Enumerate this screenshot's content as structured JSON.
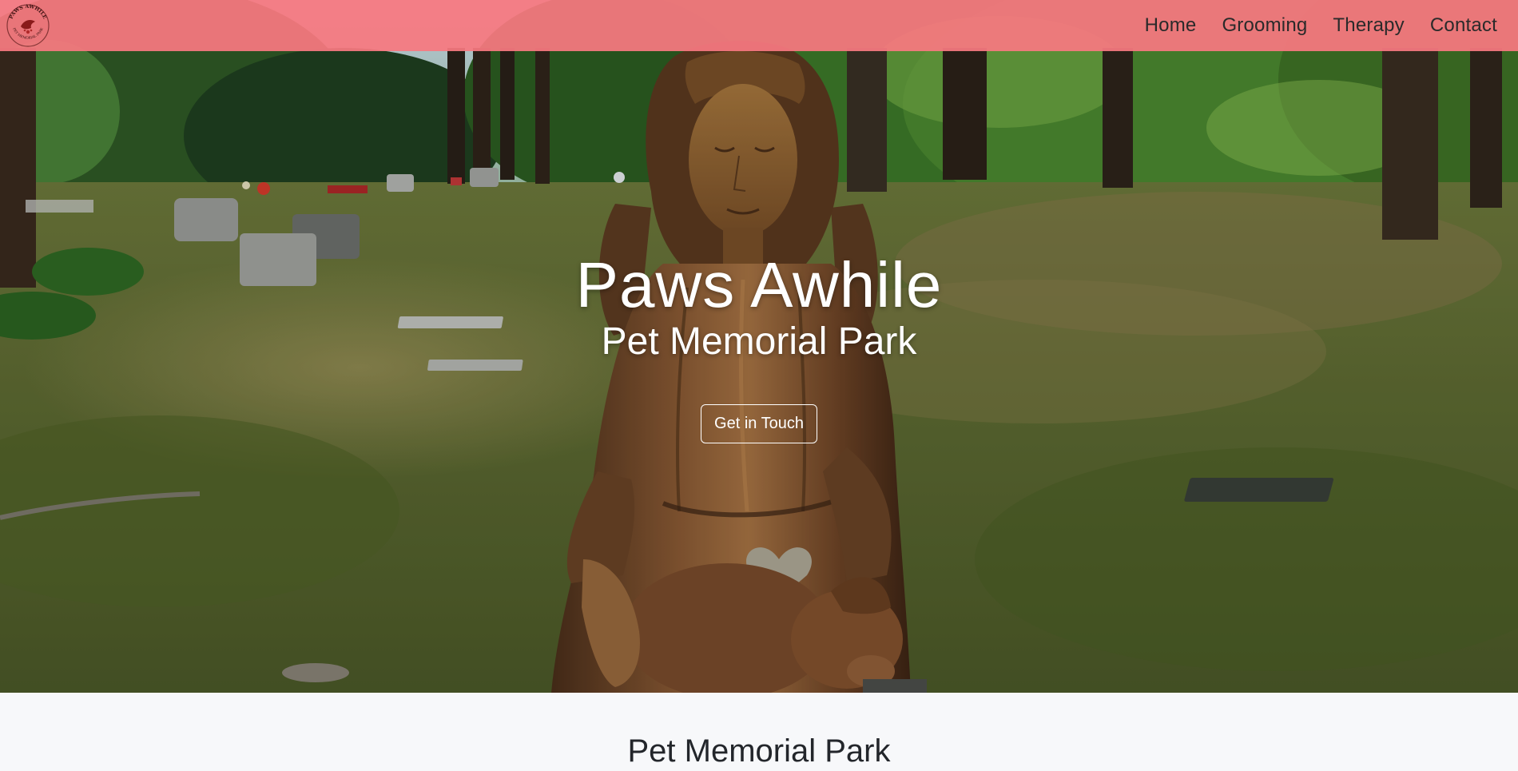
{
  "brand": {
    "logo_icon": "paws-awhile-logo-icon",
    "logo_text_top": "PAWS AWHILE",
    "logo_text_bottom": "PET MEMORIAL PARK"
  },
  "nav": {
    "items": [
      {
        "label": "Home"
      },
      {
        "label": "Grooming"
      },
      {
        "label": "Therapy"
      },
      {
        "label": "Contact"
      }
    ]
  },
  "hero": {
    "title": "Paws Awhile",
    "subtitle": "Pet Memorial Park",
    "cta_label": "Get in Touch"
  },
  "section": {
    "title": "Pet Memorial Park"
  },
  "colors": {
    "navbar_bg": "#f77880",
    "hero_text": "#ffffff",
    "section_bg": "#f7f8fa",
    "section_title": "#23262b"
  }
}
